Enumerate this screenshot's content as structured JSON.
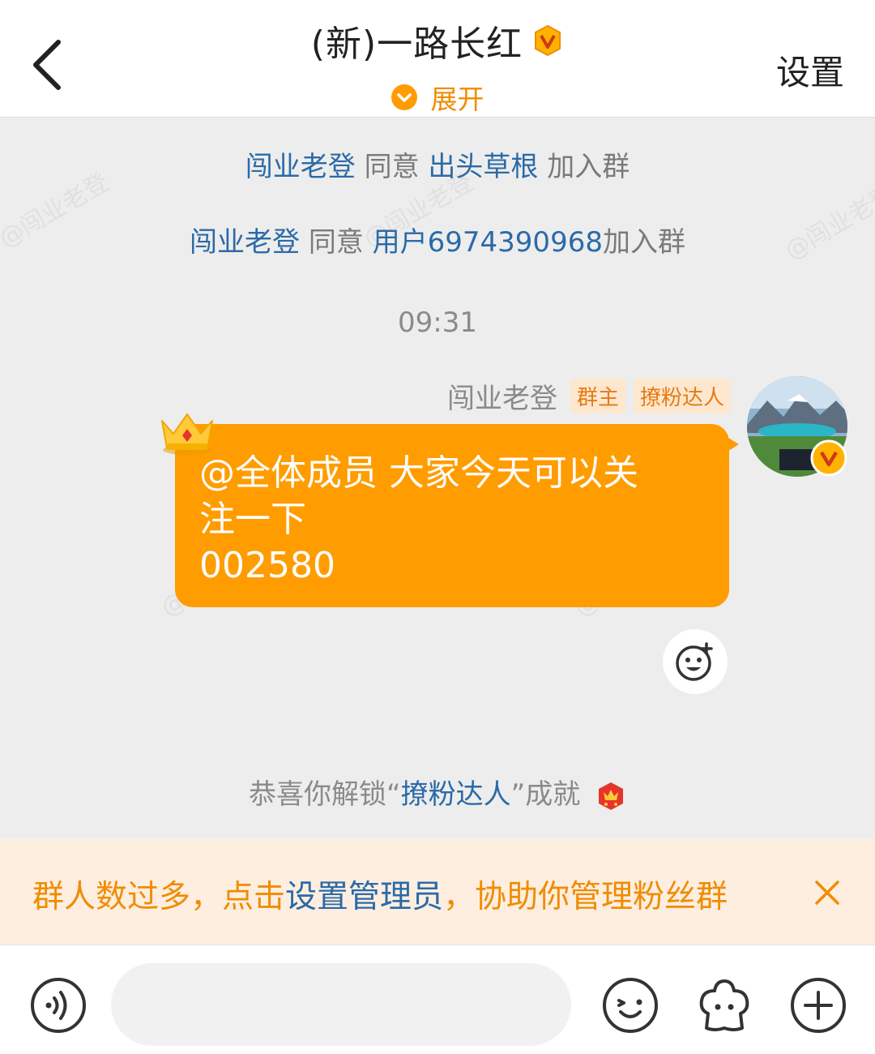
{
  "header": {
    "title": "(新)一路长红",
    "expand_label": "展开",
    "settings_label": "设置"
  },
  "watermark": "@闯业老登",
  "system_messages": [
    {
      "approver": "闯业老登",
      "verb": "同意",
      "member": "出头草根",
      "action": "加入群"
    },
    {
      "approver": "闯业老登",
      "verb": "同意",
      "member": "用户6974390968",
      "action": "加入群"
    }
  ],
  "timestamp": "09:31",
  "message": {
    "sender": "闯业老登",
    "tags": [
      "群主",
      "撩粉达人"
    ],
    "text": "@全体成员 大家今天可以关\n注一下\n002580"
  },
  "achievement": {
    "prefix": "恭喜你解锁“",
    "name": "撩粉达人",
    "suffix": "”成就"
  },
  "notice": {
    "part1": "群人数过多，点击",
    "link": "设置管理员",
    "part2": "，协助你管理粉丝群"
  },
  "input": {
    "placeholder": ""
  },
  "colors": {
    "accent": "#ff9c00",
    "link": "#2b6aa8",
    "notice_bg": "#fdeee0"
  }
}
